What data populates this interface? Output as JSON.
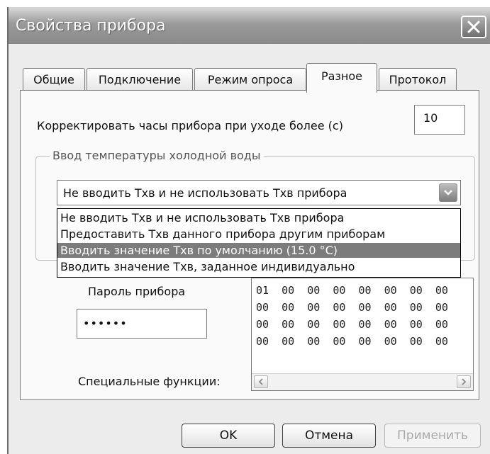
{
  "window": {
    "title": "Свойства прибора",
    "close_icon": "close-icon"
  },
  "tabs": [
    {
      "label": "Общие",
      "active": false
    },
    {
      "label": "Подключение",
      "active": false
    },
    {
      "label": "Режим опроса",
      "active": false
    },
    {
      "label": "Разное",
      "active": true
    },
    {
      "label": "Протокол",
      "active": false
    }
  ],
  "misc": {
    "clock_label": "Корректировать часы прибора при уходе более (с)",
    "clock_value": "10",
    "cold_water_group": "Ввод температуры холодной воды",
    "combo_value": "Не вводить Тхв и не использовать Тхв прибора",
    "options": [
      "Не вводить Тхв и не использовать Тхв прибора",
      "Предоставить Тхв данного прибора другим приборам",
      "Вводить значение Тхв по умолчанию (15.0 °C)",
      "Вводить значение Тхв, заданное индивидуально"
    ],
    "selected_option_index": 2,
    "password_label": "Пароль прибора",
    "password_value": "••••••",
    "special_label": "Специальные функции:",
    "hex_rows": [
      "01  00  00  00  00  00  00  00",
      "00  00  00  00  00  00  00  00",
      "00  00  00  00  00  00  00  00",
      "00  00  00  00  00  00  00  00"
    ]
  },
  "buttons": {
    "ok": "OK",
    "cancel": "Отмена",
    "apply": "Применить"
  },
  "colors": {
    "selected_bg": "#7c7c7c",
    "titlebar": "#8a8a8a"
  }
}
